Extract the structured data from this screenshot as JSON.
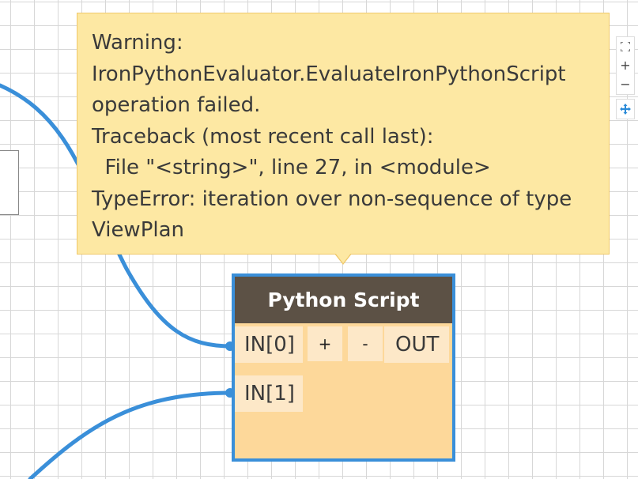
{
  "tooltip": {
    "text": "Warning:\nIronPythonEvaluator.EvaluateIronPythonScript\noperation failed.\nTraceback (most recent call last):\n  File \"<string>\", line 27, in <module>\nTypeError: iteration over non-sequence of type\nViewPlan"
  },
  "zoom_controls": {
    "fit_icon": "fit-to-screen-icon",
    "zoom_in_label": "+",
    "zoom_out_label": "−",
    "pan_icon": "pan-move-icon"
  },
  "node": {
    "title": "Python Script",
    "inputs": [
      "IN[0]",
      "IN[1]"
    ],
    "output": "OUT",
    "add_input_label": "+",
    "remove_input_label": "-",
    "state": "warning"
  },
  "colors": {
    "wire": "#3a8fd9",
    "node_header": "#5c5145",
    "node_body": "#fdd89a",
    "tooltip_bg": "#fde8a3",
    "selection_border": "#3a8fd9"
  }
}
